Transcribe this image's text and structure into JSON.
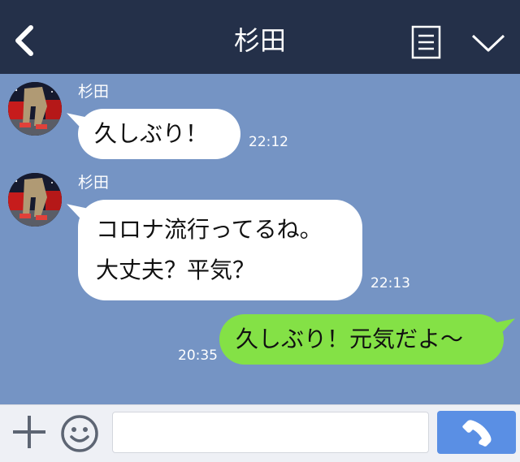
{
  "header": {
    "title": "杉田",
    "back_icon": "chevron-left-icon",
    "menu_icon": "notes-icon",
    "collapse_icon": "chevron-down-icon",
    "background": "#243049"
  },
  "chat": {
    "background": "#7594c4",
    "messages": [
      {
        "direction": "incoming",
        "sender": "杉田",
        "lines": [
          "久しぶり！"
        ],
        "time": "22:12"
      },
      {
        "direction": "incoming",
        "sender": "杉田",
        "lines": [
          "コロナ流行ってるね。",
          "大丈夫？平気？"
        ],
        "time": "22:13"
      },
      {
        "direction": "outgoing",
        "lines": [
          "久しぶり！元気だよ〜"
        ],
        "time": "20:35"
      }
    ]
  },
  "footer": {
    "add_icon": "plus-icon",
    "emoji_icon": "smile-icon",
    "input_placeholder": "",
    "call_icon": "phone-icon",
    "call_color": "#5a8fe4"
  },
  "colors": {
    "outgoing_bubble": "#84e146",
    "incoming_bubble": "#ffffff"
  }
}
